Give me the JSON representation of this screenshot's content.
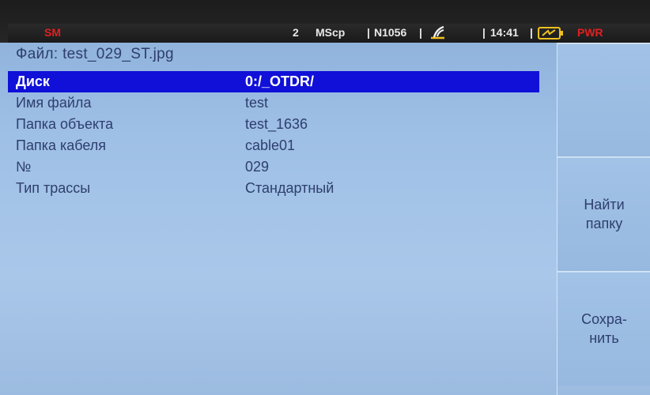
{
  "status_bar": {
    "mode": "SM",
    "channel": "2",
    "averaging": "MScp",
    "separator": "|",
    "count": "N1056",
    "time": "14:41",
    "power": "PWR",
    "icons": [
      "probe-icon",
      "battery-charging-icon"
    ]
  },
  "file": {
    "title": "Файл:   test_029_ST.jpg"
  },
  "fields": [
    {
      "label": "Диск",
      "value": "0:/_OTDR/",
      "selected": true
    },
    {
      "label": "Имя файла",
      "value": "test"
    },
    {
      "label": "Папка объекта",
      "value": "test_1636"
    },
    {
      "label": "Папка кабеля",
      "value": "cable01"
    },
    {
      "label": "№",
      "value": "029"
    },
    {
      "label": "Тип трассы",
      "value": "Стандартный"
    }
  ],
  "softkeys": [
    {
      "line1": "",
      "line2": ""
    },
    {
      "line1": "Найти",
      "line2": "папку"
    },
    {
      "line1": "Сохра-",
      "line2": "нить"
    }
  ],
  "colors": {
    "background": "#9fc0e6",
    "selection": "#1010d8",
    "text": "#2e3e6e",
    "alert": "#e02020"
  }
}
